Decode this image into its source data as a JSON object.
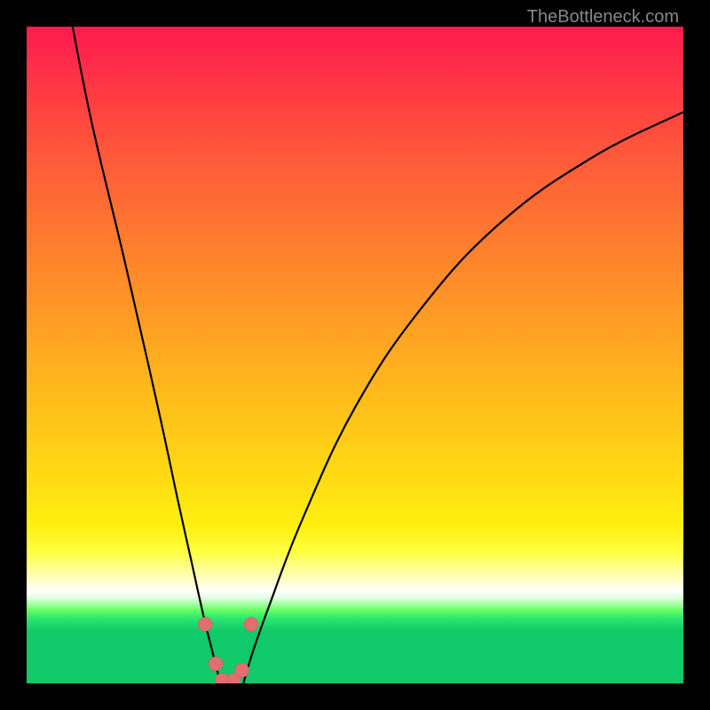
{
  "watermark": "TheBottleneck.com",
  "chart_data": {
    "type": "line",
    "title": "",
    "xlabel": "",
    "ylabel": "",
    "ylim": [
      0,
      100
    ],
    "xlim": [
      0,
      100
    ],
    "series": [
      {
        "name": "left-curve",
        "x": [
          7,
          10,
          15,
          20,
          23,
          25,
          27,
          28.5,
          29.5
        ],
        "values": [
          100,
          85,
          64,
          42,
          28,
          19,
          10,
          4,
          0
        ]
      },
      {
        "name": "right-curve",
        "x": [
          33,
          34.5,
          37,
          42,
          50,
          60,
          72,
          86,
          100
        ],
        "values": [
          0,
          5,
          12,
          25,
          42,
          57,
          70,
          80,
          87
        ]
      }
    ],
    "markers": {
      "name": "bottom-markers",
      "x": [
        27.2,
        28.8,
        29.8,
        31.5,
        32.8,
        34.2
      ],
      "values": [
        9,
        3,
        0.5,
        0.5,
        2,
        9
      ]
    },
    "gradient_zones": "red-to-green vertical, valley shape indicates optimal bottleneck point around x=30"
  }
}
